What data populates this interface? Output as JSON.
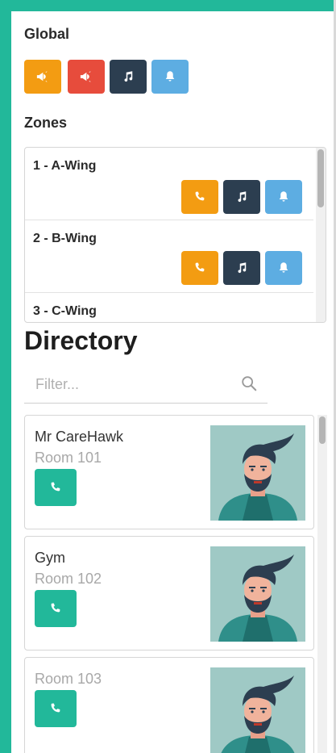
{
  "global": {
    "label": "Global",
    "buttons": [
      {
        "icon": "megaphone-icon",
        "color": "#f39c12"
      },
      {
        "icon": "megaphone-icon",
        "color": "#e74c3c"
      },
      {
        "icon": "music-note-icon",
        "color": "#2c3e50"
      },
      {
        "icon": "bell-icon",
        "color": "#5dade2"
      }
    ]
  },
  "zones": {
    "label": "Zones",
    "items": [
      {
        "name": "1 - A-Wing",
        "buttons": [
          "phone-icon",
          "music-note-icon",
          "bell-icon"
        ]
      },
      {
        "name": "2 - B-Wing",
        "buttons": [
          "phone-icon",
          "music-note-icon",
          "bell-icon"
        ]
      },
      {
        "name": "3 - C-Wing",
        "buttons": []
      }
    ]
  },
  "directory": {
    "title": "Directory",
    "filter_placeholder": "Filter...",
    "entries": [
      {
        "name": "Mr CareHawk",
        "room": "Room 101",
        "avatar": "avatar-illustration"
      },
      {
        "name": "Gym",
        "room": "Room 102",
        "avatar": "avatar-illustration"
      },
      {
        "name": "",
        "room": "Room 103",
        "avatar": "avatar-illustration"
      }
    ]
  },
  "colors": {
    "accent": "#22b89a",
    "orange": "#f39c12",
    "red": "#e74c3c",
    "navy": "#2c3e50",
    "blue": "#5dade2"
  }
}
